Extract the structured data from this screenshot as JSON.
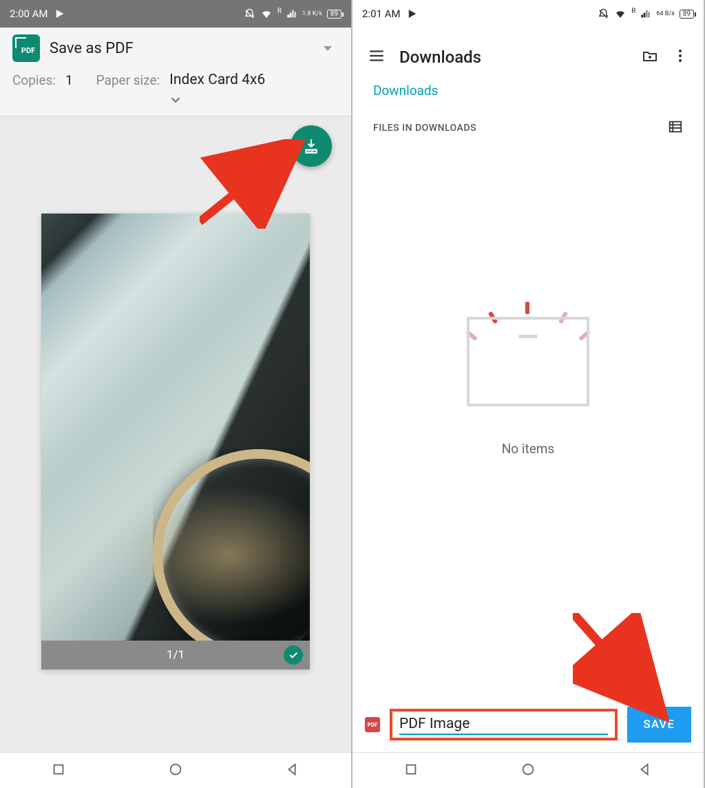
{
  "left": {
    "statusbar": {
      "time": "2:00 AM",
      "net_rate": "1.8 K/s",
      "network_label": "R",
      "battery": "89"
    },
    "print": {
      "destination": "Save as PDF",
      "copies_label": "Copies:",
      "copies_value": "1",
      "paper_label": "Paper size:",
      "paper_value": "Index Card 4x6"
    },
    "preview": {
      "page_counter": "1/1"
    }
  },
  "right": {
    "statusbar": {
      "time": "2:01 AM",
      "net_rate": "64 B/s",
      "network_label": "R",
      "battery": "89"
    },
    "header": {
      "title": "Downloads"
    },
    "breadcrumb": "Downloads",
    "section_label": "FILES IN DOWNLOADS",
    "empty_text": "No items",
    "filename_value": "PDF Image",
    "save_button": "SAVE"
  },
  "icons": {
    "pdf_small": "PDF"
  }
}
